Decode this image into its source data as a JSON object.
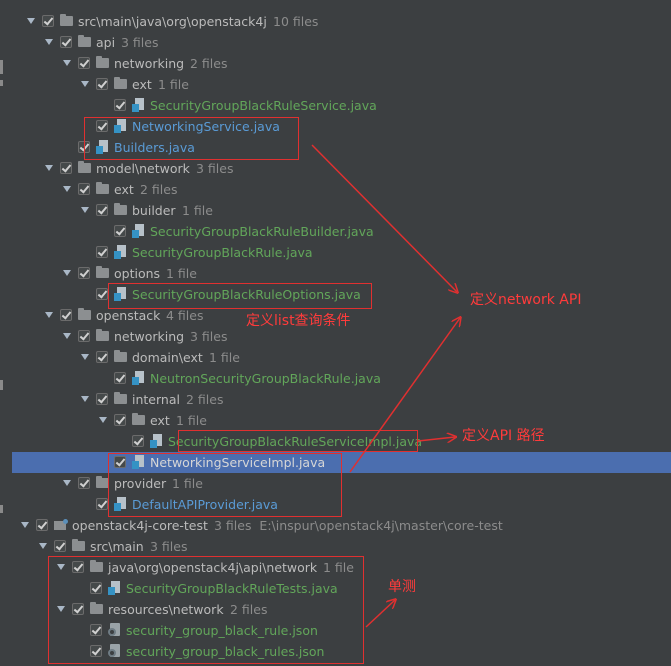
{
  "tree": [
    {
      "label": "src\\main\\java\\org\\openstack4j",
      "count": "10 files",
      "type": "folder",
      "level": 0,
      "arrow": true,
      "color": "dir"
    },
    {
      "label": "api",
      "count": "3 files",
      "type": "folder",
      "level": 1,
      "arrow": true,
      "color": "dir"
    },
    {
      "label": "networking",
      "count": "2 files",
      "type": "folder",
      "level": 2,
      "arrow": true,
      "color": "dir"
    },
    {
      "label": "ext",
      "count": "1 file",
      "type": "folder",
      "level": 3,
      "arrow": true,
      "color": "dir"
    },
    {
      "label": "SecurityGroupBlackRuleService.java",
      "count": "",
      "type": "java",
      "level": 4,
      "arrow": false,
      "color": "green"
    },
    {
      "label": "NetworkingService.java",
      "count": "",
      "type": "java",
      "level": 3,
      "arrow": false,
      "color": "blue"
    },
    {
      "label": "Builders.java",
      "count": "",
      "type": "java",
      "level": 2,
      "arrow": false,
      "color": "blue"
    },
    {
      "label": "model\\network",
      "count": "3 files",
      "type": "folder",
      "level": 1,
      "arrow": true,
      "color": "dir"
    },
    {
      "label": "ext",
      "count": "2 files",
      "type": "folder",
      "level": 2,
      "arrow": true,
      "color": "dir"
    },
    {
      "label": "builder",
      "count": "1 file",
      "type": "folder",
      "level": 3,
      "arrow": true,
      "color": "dir"
    },
    {
      "label": "SecurityGroupBlackRuleBuilder.java",
      "count": "",
      "type": "java",
      "level": 4,
      "arrow": false,
      "color": "green"
    },
    {
      "label": "SecurityGroupBlackRule.java",
      "count": "",
      "type": "java",
      "level": 3,
      "arrow": false,
      "color": "green"
    },
    {
      "label": "options",
      "count": "1 file",
      "type": "folder",
      "level": 2,
      "arrow": true,
      "color": "dir"
    },
    {
      "label": "SecurityGroupBlackRuleOptions.java",
      "count": "",
      "type": "java",
      "level": 3,
      "arrow": false,
      "color": "green"
    },
    {
      "label": "openstack",
      "count": "4 files",
      "type": "folder",
      "level": 1,
      "arrow": true,
      "color": "dir"
    },
    {
      "label": "networking",
      "count": "3 files",
      "type": "folder",
      "level": 2,
      "arrow": true,
      "color": "dir"
    },
    {
      "label": "domain\\ext",
      "count": "1 file",
      "type": "folder",
      "level": 3,
      "arrow": true,
      "color": "dir"
    },
    {
      "label": "NeutronSecurityGroupBlackRule.java",
      "count": "",
      "type": "java",
      "level": 4,
      "arrow": false,
      "color": "green"
    },
    {
      "label": "internal",
      "count": "2 files",
      "type": "folder",
      "level": 3,
      "arrow": true,
      "color": "dir"
    },
    {
      "label": "ext",
      "count": "1 file",
      "type": "folder",
      "level": 4,
      "arrow": true,
      "color": "dir"
    },
    {
      "label": "SecurityGroupBlackRuleServiceImpl.java",
      "count": "",
      "type": "java",
      "level": 5,
      "arrow": false,
      "color": "green"
    },
    {
      "label": "NetworkingServiceImpl.java",
      "count": "",
      "type": "java",
      "level": 4,
      "arrow": false,
      "color": "white",
      "selected": true
    },
    {
      "label": "provider",
      "count": "1 file",
      "type": "folder",
      "level": 2,
      "arrow": true,
      "color": "dir"
    },
    {
      "label": "DefaultAPIProvider.java",
      "count": "",
      "type": "java",
      "level": 3,
      "arrow": false,
      "color": "blue"
    },
    {
      "label": "openstack4j-core-test",
      "count": "3 files  E:\\inspur\\openstack4j\\master\\core-test",
      "type": "module",
      "level": 0,
      "arrow": true,
      "color": "dir",
      "x": 8
    },
    {
      "label": "src\\main",
      "count": "3 files",
      "type": "folder",
      "level": 1,
      "arrow": true,
      "color": "dir",
      "x": 8
    },
    {
      "label": "java\\org\\openstack4j\\api\\network",
      "count": "1 file",
      "type": "folder",
      "level": 2,
      "arrow": true,
      "color": "dir",
      "x": 8
    },
    {
      "label": "SecurityGroupBlackRuleTests.java",
      "count": "",
      "type": "java",
      "level": 3,
      "arrow": false,
      "color": "green",
      "x": 8
    },
    {
      "label": "resources\\network",
      "count": "2 files",
      "type": "folder",
      "level": 2,
      "arrow": true,
      "color": "dir",
      "x": 8
    },
    {
      "label": "security_group_black_rule.json",
      "count": "",
      "type": "json",
      "level": 3,
      "arrow": false,
      "color": "green",
      "x": 8
    },
    {
      "label": "security_group_black_rules.json",
      "count": "",
      "type": "json",
      "level": 3,
      "arrow": false,
      "color": "green",
      "x": 8
    }
  ],
  "annotations": {
    "list_query": "定义list查询条件",
    "network_api": "定义network API",
    "api_path": "定义API 路径",
    "unit_test": "单测"
  },
  "colors": {
    "background": "#3c3f41",
    "selection": "#4b6eaf",
    "annotation_red": "#e03030"
  }
}
